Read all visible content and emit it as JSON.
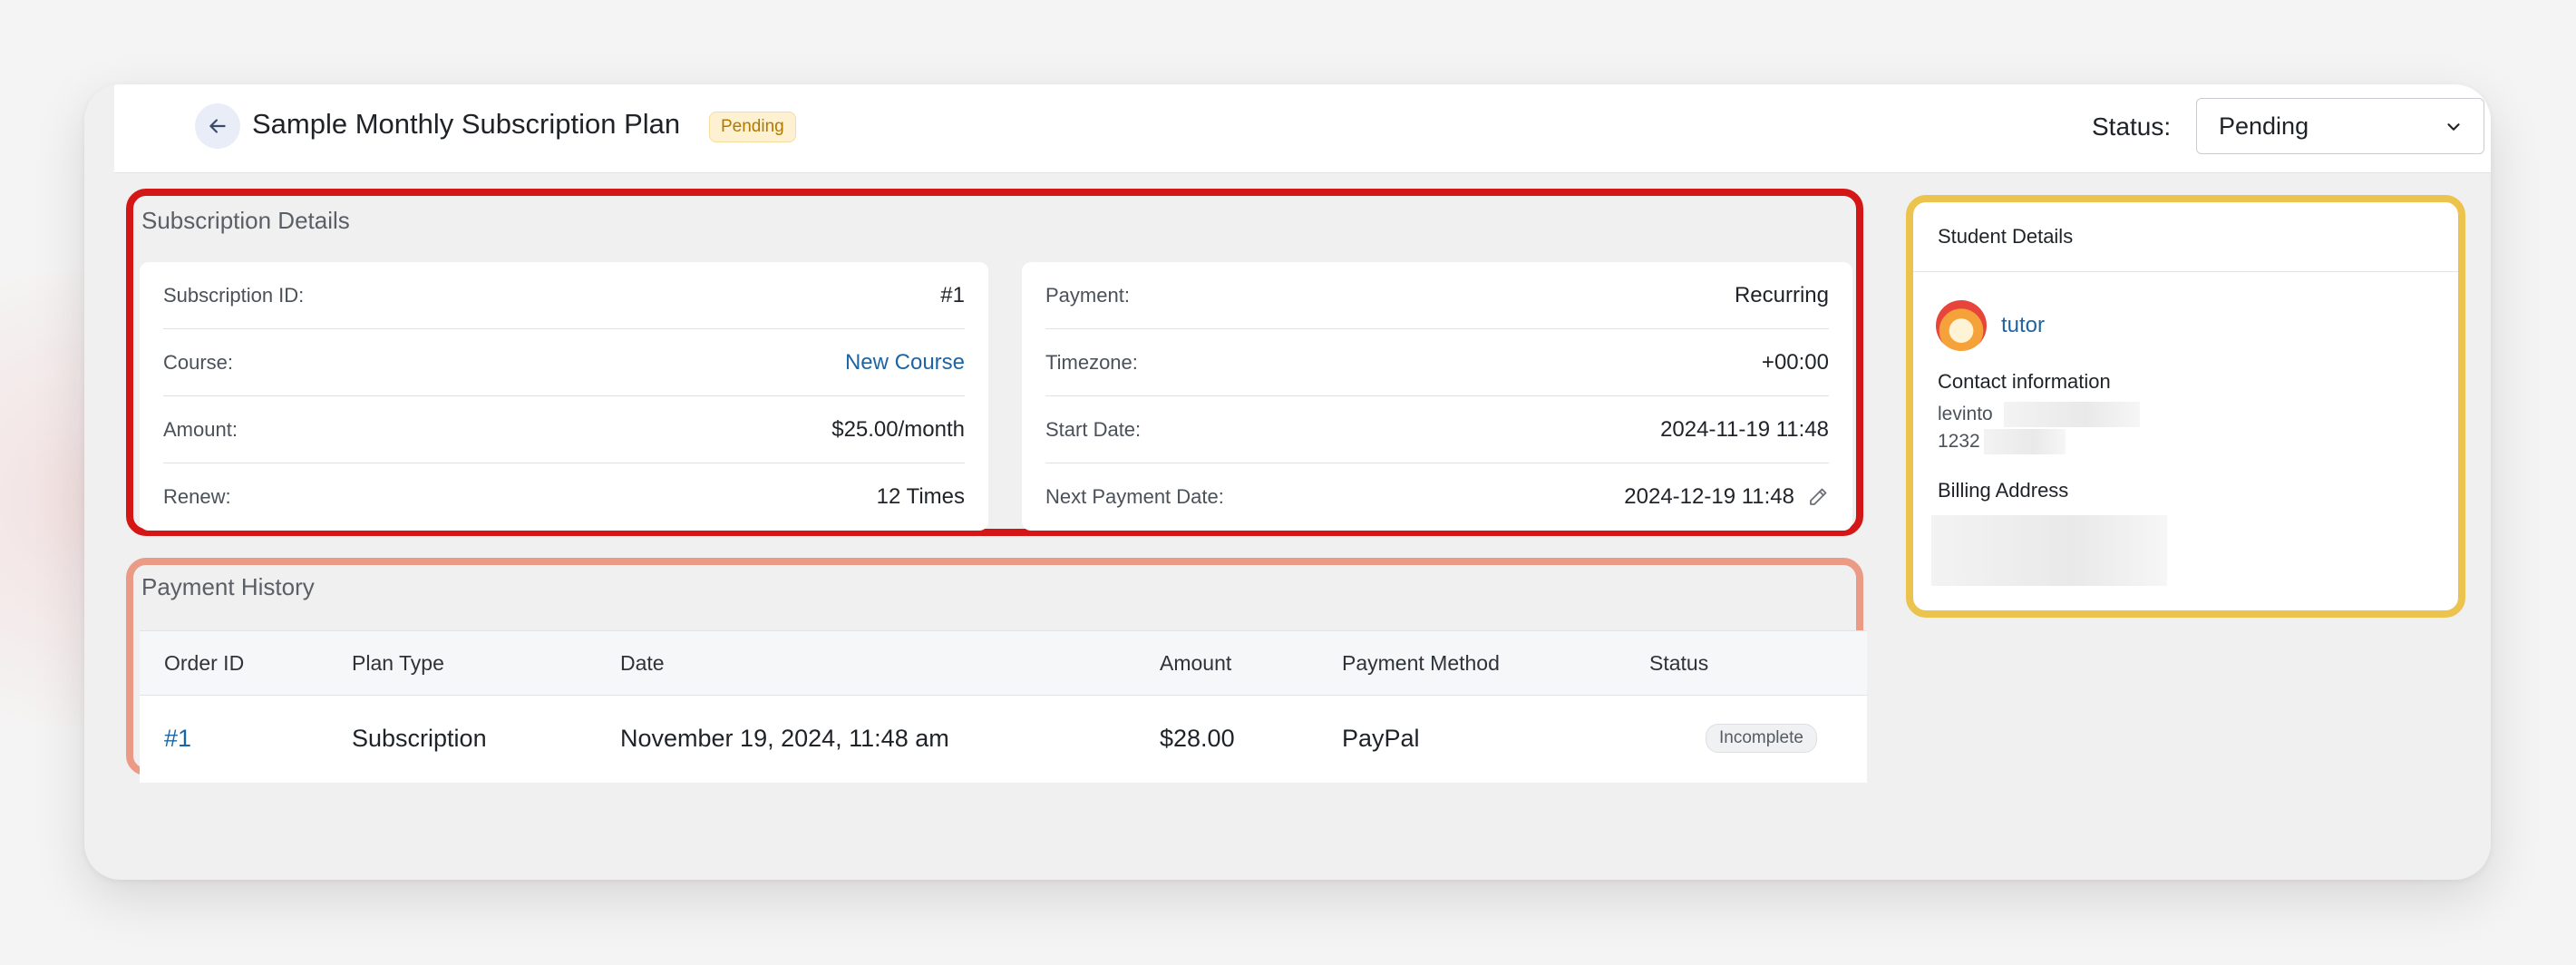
{
  "header": {
    "title": "Sample Monthly Subscription Plan",
    "title_badge": "Pending",
    "status_label": "Status:",
    "status_value": "Pending"
  },
  "subscription_details": {
    "title": "Subscription Details",
    "left": [
      {
        "label": "Subscription ID:",
        "value": "#1"
      },
      {
        "label": "Course:",
        "value": "New Course"
      },
      {
        "label": "Amount:",
        "value": "$25.00/month"
      },
      {
        "label": "Renew:",
        "value": "12 Times"
      }
    ],
    "right": [
      {
        "label": "Payment:",
        "value": "Recurring"
      },
      {
        "label": "Timezone:",
        "value": "+00:00"
      },
      {
        "label": "Start Date:",
        "value": "2024-11-19 11:48"
      },
      {
        "label": "Next Payment Date:",
        "value": "2024-12-19 11:48"
      }
    ]
  },
  "payment_history": {
    "title": "Payment History",
    "columns": [
      "Order ID",
      "Plan Type",
      "Date",
      "Amount",
      "Payment Method",
      "Status"
    ],
    "rows": [
      {
        "order_id": "#1",
        "plan_type": "Subscription",
        "date": "November 19, 2024, 11:48 am",
        "amount": "$28.00",
        "payment_method": "PayPal",
        "status": "Incomplete"
      }
    ]
  },
  "student_details": {
    "title": "Student Details",
    "name": "tutor",
    "contact_label": "Contact information",
    "email_partial": "levinto",
    "phone_partial": "1232",
    "billing_label": "Billing Address"
  },
  "colors": {
    "subscription_highlight": "#d41616",
    "payment_highlight": "#eb9a85",
    "student_highlight": "#ecc34d",
    "link": "#1e64a4",
    "pending_badge_bg": "#fdf1d2"
  },
  "icons": [
    "arrow-left-icon",
    "chevron-down-icon",
    "pencil-icon",
    "avatar"
  ]
}
